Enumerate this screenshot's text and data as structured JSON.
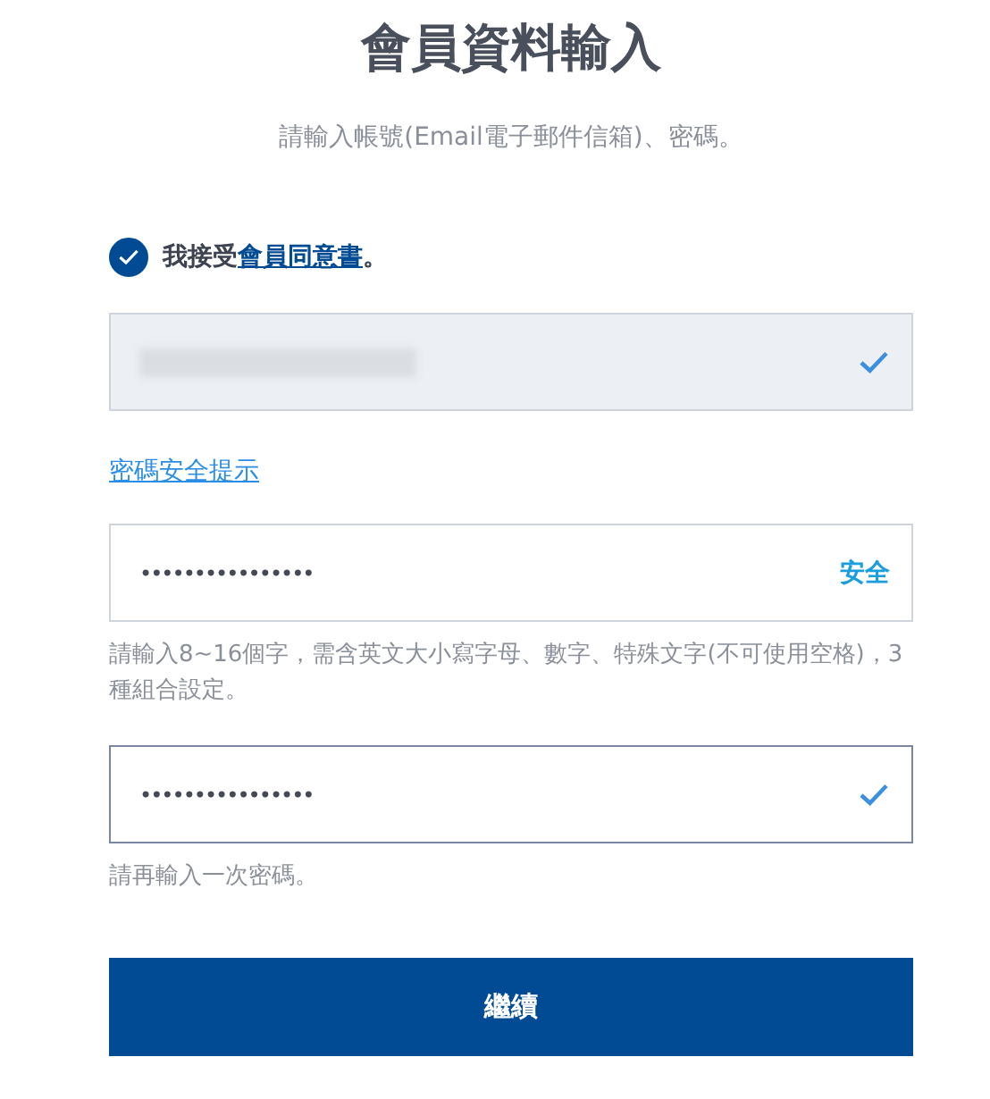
{
  "title": "會員資料輸入",
  "subtitle": "請輸入帳號(Email電子郵件信箱)、密碼。",
  "agreement": {
    "checked": true,
    "prefix": "我接受",
    "link": "會員同意書",
    "suffix": "。"
  },
  "email_field": {
    "kind": "redacted",
    "valid": true
  },
  "password_tips_link": "密碼安全提示",
  "password_field": {
    "value": "••••••••••••••••",
    "strength": "安全"
  },
  "password_hint": "請輸入8~16個字，需含英文大小寫字母、數字、特殊文字(不可使用空格)，3種組合設定。",
  "confirm_field": {
    "value": "••••••••••••••••",
    "valid": true,
    "focused": true
  },
  "confirm_hint": "請再輸入一次密碼。",
  "continue_button": "繼續"
}
